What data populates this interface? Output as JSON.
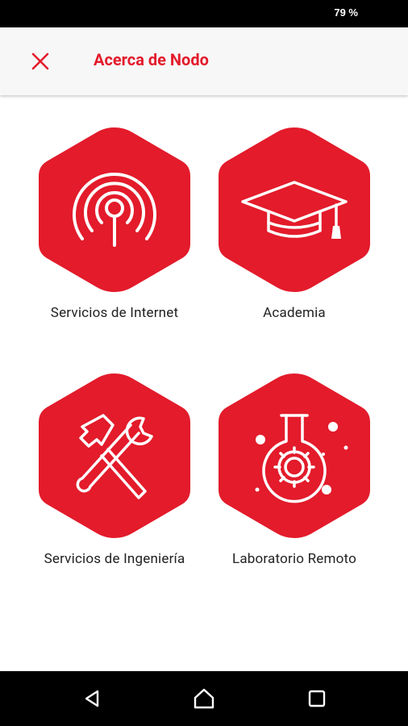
{
  "status_bar": {
    "battery_text": "79 %"
  },
  "app_bar": {
    "title": "Acerca de Nodo",
    "close_icon": "close-icon"
  },
  "tiles": [
    {
      "label": "Servicios de Internet",
      "icon": "wireless-antenna-icon"
    },
    {
      "label": "Academia",
      "icon": "graduation-cap-icon"
    },
    {
      "label": "Servicios de Ingeniería",
      "icon": "hammer-wrench-icon"
    },
    {
      "label": "Laboratorio Remoto",
      "icon": "flask-gear-icon"
    }
  ],
  "nav_bar": {
    "back": "back-icon",
    "home": "home-icon",
    "recents": "recents-icon"
  },
  "colors": {
    "accent": "#e31b2b",
    "app_bar_bg": "#f7f7f7",
    "bars": "#000000"
  }
}
